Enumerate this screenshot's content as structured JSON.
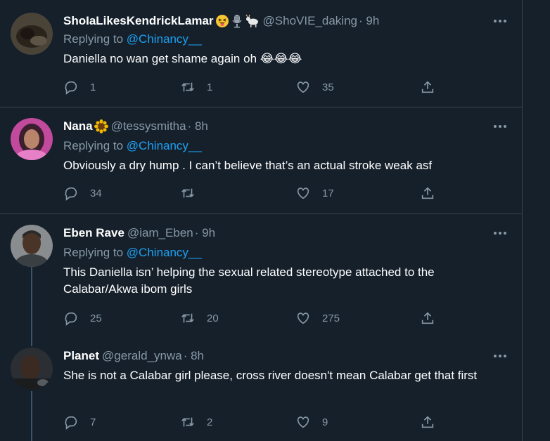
{
  "tweets": [
    {
      "name": "ShoIaLikesKendrickLamar",
      "handle": "@ShoVIE_daking",
      "time": "· 9h",
      "replying_prefix": "Replying to",
      "replying_to": "@Chinancy__",
      "text": "Daniella no wan get shame again oh 😂😂😂",
      "replies": "1",
      "retweets": "1",
      "likes": "35"
    },
    {
      "name": "Nana",
      "handle": "@tessysmitha",
      "time": "· 8h",
      "replying_prefix": "Replying to",
      "replying_to": "@Chinancy__",
      "text": "Obviously a dry hump . I can’t believe that’s an actual stroke weak asf",
      "replies": "34",
      "retweets": "",
      "likes": "17"
    },
    {
      "name": "Eben Rave",
      "handle": "@iam_Eben",
      "time": "· 9h",
      "replying_prefix": "Replying to",
      "replying_to": "@Chinancy__",
      "text": "This Daniella isn’ helping the sexual related stereotype attached to the Calabar/Akwa ibom girls",
      "replies": "25",
      "retweets": "20",
      "likes": "275"
    },
    {
      "name": "Planet",
      "handle": "@gerald_ynwa",
      "time": "· 8h",
      "text": "She is not a Calabar girl please, cross river doesn't mean Calabar get that first",
      "replies": "7",
      "retweets": "2",
      "likes": "9"
    }
  ],
  "icons": {
    "emoji_1": "squinting-tongue-face",
    "emoji_2": "microphone",
    "emoji_3": "goat",
    "emoji_4": "sunflower"
  },
  "colors": {
    "background": "#15202b",
    "mention": "#1da1f2",
    "secondary_text": "#8899a6"
  }
}
